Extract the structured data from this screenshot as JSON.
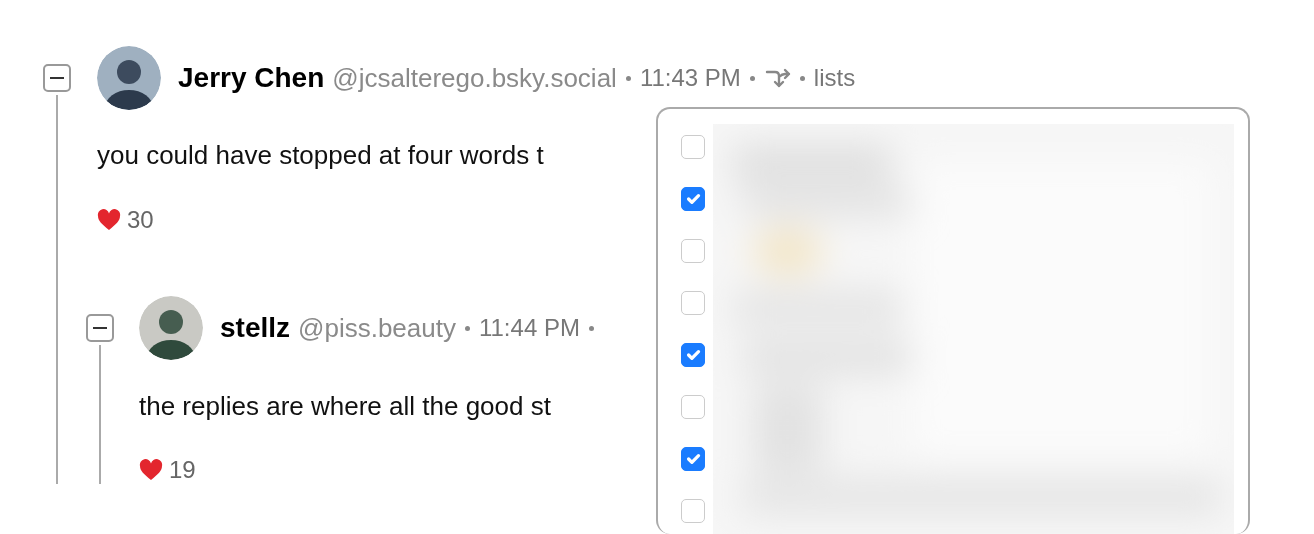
{
  "thread": [
    {
      "author": "Jerry Chen",
      "handle": "@jcsalterego.bsky.social",
      "time": "11:43 PM",
      "expanded": true,
      "lists_link": "lists",
      "text": "you could have stopped at four words t",
      "likes": "30",
      "replies": [
        {
          "author": "stellz",
          "handle": "@piss.beauty",
          "time": "11:44 PM",
          "expanded": true,
          "text": "the replies are where all the good st",
          "likes": "19"
        }
      ]
    }
  ],
  "lists_menu": {
    "items": [
      {
        "checked": false
      },
      {
        "checked": true
      },
      {
        "checked": false
      },
      {
        "checked": false
      },
      {
        "checked": true
      },
      {
        "checked": false
      },
      {
        "checked": true
      },
      {
        "checked": false
      }
    ]
  }
}
